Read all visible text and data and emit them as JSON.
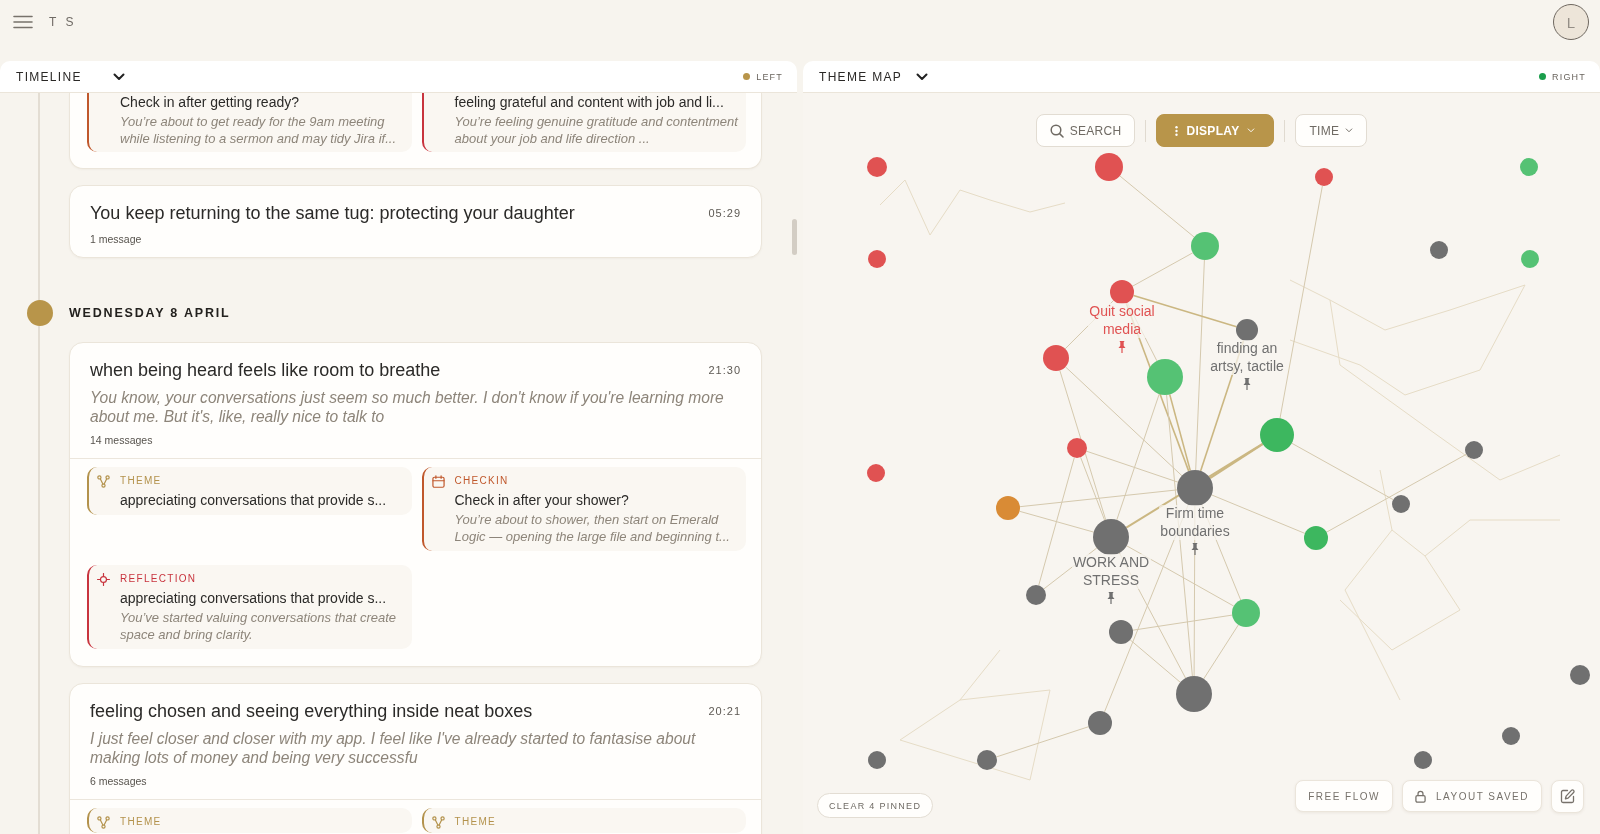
{
  "app": {
    "initials": "T S",
    "avatar": "L"
  },
  "panes": [
    {
      "kind": "timeline",
      "title": "TIMELINE",
      "side": "LEFT",
      "color": "#b8954a",
      "items": [
        {
          "kind": "conversation",
          "subcards": [
            {
              "kind": "checkin",
              "title": "Check in after getting ready?",
              "body": "You’re about to get ready for the 9am meeting while listening to a sermon and may tidy Jira if..."
            },
            {
              "kind": "reflection",
              "title": "feeling grateful and content with job and li...",
              "body": "You’re feeling genuine gratitude and contentment about your job and life direction ..."
            }
          ]
        },
        {
          "kind": "conversation",
          "title": "You keep returning to the same tug: protecting your daughter",
          "time": "05:29",
          "count": "1 message"
        },
        {
          "kind": "day",
          "label": "WEDNESDAY 8 APRIL"
        },
        {
          "kind": "conversation",
          "title": "when being heard feels like room to breathe",
          "time": "21:30",
          "preview": "You know, your conversations just seem so much better. I don't know if you're learning more about me. But it's, like, really nice to talk to",
          "count": "14 messages",
          "subcards": [
            {
              "kind": "theme",
              "label": "THEME",
              "title": "appreciating conversations that provide s..."
            },
            {
              "kind": "checkin",
              "label": "CHECKIN",
              "title": "Check in after your shower?",
              "body": "You’re about to shower, then start on Emerald Logic — opening the large file and beginning t..."
            },
            {
              "kind": "reflection",
              "label": "REFLECTION",
              "title": "appreciating conversations that provide s...",
              "body": "You’ve started valuing conversations that create space and bring clarity."
            }
          ]
        },
        {
          "kind": "conversation",
          "title": "feeling chosen and seeing everything inside neat boxes",
          "time": "20:21",
          "preview": "I just feel closer and closer with my app. I feel like I've already started to fantasise about making lots of money and being very successfu",
          "count": "6 messages",
          "subcards": [
            {
              "kind": "theme",
              "label": "THEME"
            },
            {
              "kind": "theme",
              "label": "THEME"
            }
          ]
        }
      ]
    },
    {
      "kind": "theme_map",
      "title": "THEME MAP",
      "side": "RIGHT",
      "color": "#1a9e4b",
      "toolbar": [
        {
          "kind": "search",
          "label": "SEARCH",
          "active": false
        },
        {
          "kind": "menu",
          "label": "DISPLAY",
          "active": true
        },
        {
          "kind": "dropdown",
          "label": "TIME",
          "active": false
        }
      ],
      "nodes": [
        {
          "color": "#e05252",
          "pinned": false
        },
        {
          "color": "#e05252",
          "pinned": false
        },
        {
          "color": "#e05252",
          "pinned": false
        },
        {
          "color": "#55c274",
          "pinned": false
        },
        {
          "color": "#e05252",
          "pinned": false
        },
        {
          "color": "#55c274",
          "pinned": false
        },
        {
          "color": "#707070",
          "pinned": false
        },
        {
          "color": "#55c274",
          "pinned": false
        },
        {
          "color": "#e05252",
          "label": "Quit social media",
          "pinned": true
        },
        {
          "color": "#707070",
          "label": "finding an artsy, tactile",
          "pinned": true
        },
        {
          "color": "#e05252",
          "pinned": false
        },
        {
          "color": "#55c274",
          "pinned": false
        },
        {
          "color": "#3db75f",
          "pinned": false
        },
        {
          "color": "#707070",
          "pinned": false
        },
        {
          "color": "#e05252",
          "pinned": false
        },
        {
          "color": "#e05252",
          "pinned": false
        },
        {
          "color": "#707070",
          "label": "Firm time boundaries",
          "pinned": true
        },
        {
          "color": "#d98b35",
          "pinned": false
        },
        {
          "color": "#707070",
          "pinned": false
        },
        {
          "color": "#707070",
          "label": "WORK AND STRESS",
          "pinned": true
        },
        {
          "color": "#3db75f",
          "pinned": false
        },
        {
          "color": "#707070",
          "pinned": false
        },
        {
          "color": "#55c274",
          "pinned": false
        },
        {
          "color": "#707070",
          "pinned": false
        },
        {
          "color": "#707070",
          "pinned": false
        },
        {
          "color": "#707070",
          "pinned": false
        },
        {
          "color": "#707070",
          "pinned": false
        },
        {
          "color": "#707070",
          "pinned": false
        },
        {
          "color": "#707070",
          "pinned": false
        },
        {
          "color": "#707070",
          "pinned": false
        },
        {
          "color": "#707070",
          "pinned": false
        }
      ],
      "clear_pinned": "CLEAR 4 PINNED",
      "actions": [
        {
          "kind": "toggle",
          "label": "FREE FLOW"
        },
        {
          "kind": "lock",
          "label": "LAYOUT SAVED"
        },
        {
          "kind": "edit"
        }
      ]
    }
  ]
}
